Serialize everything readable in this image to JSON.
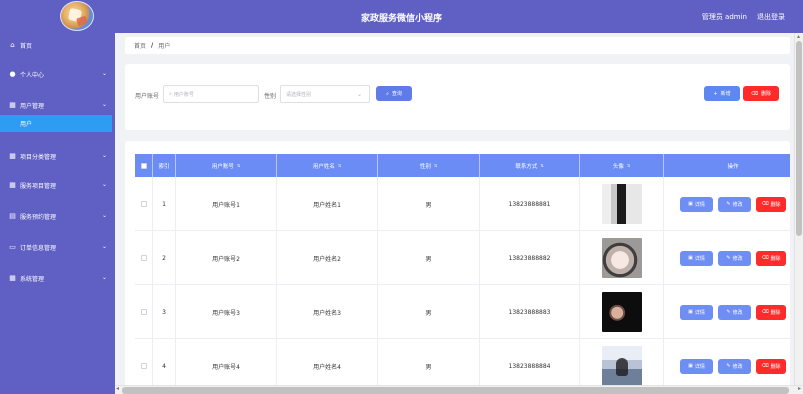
{
  "header": {
    "title": "家政服务微信小程序",
    "admin_label": "管理员 admin",
    "logout_label": "退出登录"
  },
  "sidebar": {
    "items": [
      {
        "label": "首页",
        "icon": "home-icon"
      },
      {
        "label": "个人中心",
        "icon": "user-icon"
      },
      {
        "label": "用户管理",
        "icon": "grid-icon"
      },
      {
        "label": "项目分类管理",
        "icon": "grid-icon"
      },
      {
        "label": "服务项目管理",
        "icon": "grid-icon"
      },
      {
        "label": "服务预约管理",
        "icon": "list-icon"
      },
      {
        "label": "订单信息管理",
        "icon": "briefcase-icon"
      },
      {
        "label": "系统管理",
        "icon": "grid-icon"
      }
    ],
    "sub_item": "用户"
  },
  "breadcrumb": {
    "home": "首页",
    "sep": "/",
    "current": "用户"
  },
  "search": {
    "account_label": "用户账号",
    "account_placeholder": "用户账号",
    "gender_label": "性别",
    "gender_placeholder": "请选择性别",
    "query_button": "查询",
    "add_button": "新增",
    "delete_button": "删除"
  },
  "table": {
    "headers": {
      "index": "索引",
      "account": "用户账号",
      "name": "用户姓名",
      "gender": "性别",
      "phone": "联系方式",
      "avatar": "头像",
      "actions": "操作"
    },
    "actions": {
      "detail": "详情",
      "edit": "修改",
      "delete": "删除"
    },
    "rows": [
      {
        "index": "1",
        "account": "用户账号1",
        "name": "用户姓名1",
        "gender": "男",
        "phone": "13823888881",
        "avatar": "avatar-woman-standing"
      },
      {
        "index": "2",
        "account": "用户账号2",
        "name": "用户姓名2",
        "gender": "男",
        "phone": "13823888882",
        "avatar": "avatar-woman-portrait"
      },
      {
        "index": "3",
        "account": "用户账号3",
        "name": "用户姓名3",
        "gender": "男",
        "phone": "13823888883",
        "avatar": "avatar-dark-profile"
      },
      {
        "index": "4",
        "account": "用户账号4",
        "name": "用户姓名4",
        "gender": "男",
        "phone": "13823888884",
        "avatar": "avatar-seaside-figure"
      }
    ]
  },
  "colors": {
    "primary": "#5f5fc4",
    "table_header": "#6b8cf4",
    "active_menu": "#2f9cf3",
    "danger": "#ff2b2b"
  }
}
